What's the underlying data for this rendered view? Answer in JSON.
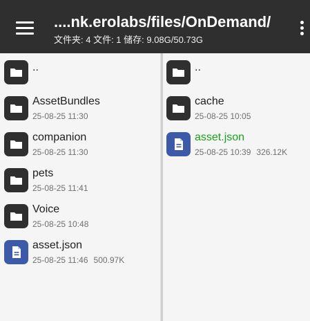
{
  "toolbar": {
    "path": "....nk.erolabs/files/OnDemand/",
    "summary": "文件夹: 4  文件: 1  储存: 9.08G/50.73G"
  },
  "left_pane": {
    "items": [
      {
        "type": "folder",
        "name": "..",
        "date": "",
        "size": ""
      },
      {
        "type": "folder",
        "name": "AssetBundles",
        "date": "25-08-25 11:30",
        "size": ""
      },
      {
        "type": "folder",
        "name": "companion",
        "date": "25-08-25 11:30",
        "size": ""
      },
      {
        "type": "folder",
        "name": "pets",
        "date": "25-08-25 11:41",
        "size": ""
      },
      {
        "type": "folder",
        "name": "Voice",
        "date": "25-08-25 10:48",
        "size": ""
      },
      {
        "type": "file",
        "name": "asset.json",
        "date": "25-08-25 11:46",
        "size": "500.97K"
      }
    ]
  },
  "right_pane": {
    "items": [
      {
        "type": "folder",
        "name": "..",
        "date": "",
        "size": ""
      },
      {
        "type": "folder",
        "name": "cache",
        "date": "25-08-25 10:05",
        "size": ""
      },
      {
        "type": "file",
        "name": "asset.json",
        "date": "25-08-25 10:39",
        "size": "326.12K",
        "highlighted": true
      }
    ]
  },
  "colors": {
    "toolbar_bg": "#2f2f2f",
    "folder_icon": "#2f2f2f",
    "file_icon": "#3d5aa8",
    "highlight_text": "#1aa01a"
  },
  "icons": {
    "menu": "hamburger-menu-icon",
    "overflow": "more-vert-icon",
    "folder": "folder-icon",
    "file": "document-icon"
  }
}
